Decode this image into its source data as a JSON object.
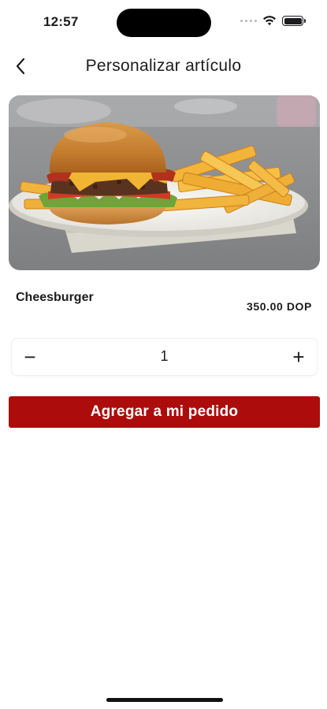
{
  "status_bar": {
    "time": "12:57",
    "icons": [
      "signal-dots-icon",
      "wifi-icon",
      "battery-icon"
    ]
  },
  "nav": {
    "title": "Personalizar artículo",
    "back_icon": "chevron-left-icon"
  },
  "product": {
    "image": "cheeseburger-with-fries-photo",
    "name": "Cheesburger",
    "price": "350.00 DOP"
  },
  "quantity": {
    "minus_label": "−",
    "value": "1",
    "plus_label": "+"
  },
  "add_button": {
    "label": "Agregar a mi pedido",
    "color": "#ad0c0c"
  }
}
